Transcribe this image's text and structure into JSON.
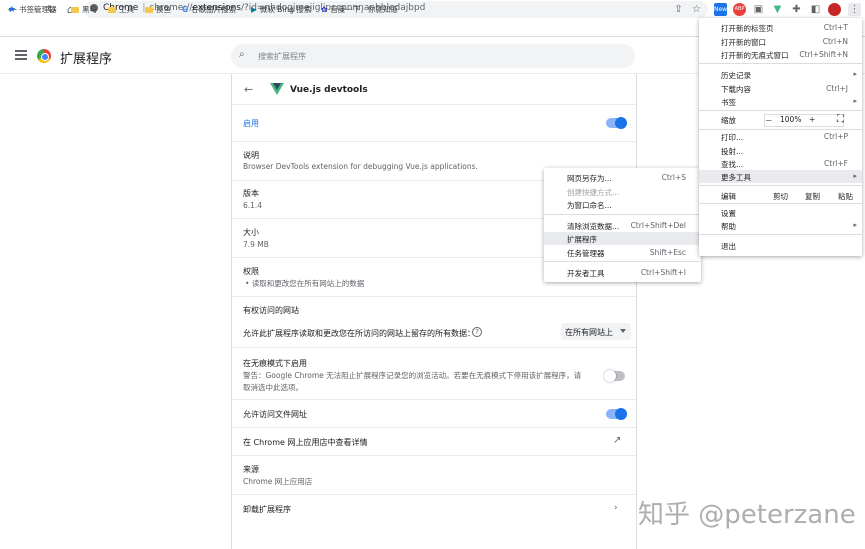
{
  "browser": {
    "site_label": "Chrome",
    "url_prefix": "chrome://",
    "url_main": "extensions",
    "url_rest": "/?id=nhdogjmejiglipccpnnnanhbledajbpd"
  },
  "bookmarks": [
    "书签管理器",
    "黑马",
    "工具",
    "摸鱼",
    "谷歌图片搜索",
    "微软 Bing 搜索",
    "百度一下，你就知道"
  ],
  "header": {
    "title": "扩展程序",
    "search_placeholder": "搜索扩展程序"
  },
  "extension": {
    "name": "Vue.js devtools",
    "enabled_label": "启用",
    "description_heading": "说明",
    "description": "Browser DevTools extension for debugging Vue.js applications.",
    "version_heading": "版本",
    "version": "6.1.4",
    "size_heading": "大小",
    "size": "7.9 MB",
    "permissions_heading": "权限",
    "permission_item": "读取和更改您在所有网站上的数据",
    "site_access_heading": "有权访问的网站",
    "site_access_desc": "允许此扩展程序读取和更改您在所访问的网站上留存的所有数据：",
    "site_access_value": "在所有网站上",
    "incognito_heading": "在无痕模式下启用",
    "incognito_warning_1": "警告：Google Chrome 无法阻止扩展程序记录您的浏览活动。若要在无痕模式下停用该扩展程序，请",
    "incognito_warning_2": "取消选中此选项。",
    "file_urls": "允许访问文件网址",
    "store_link": "在 Chrome 网上应用店中查看详情",
    "source_heading": "来源",
    "source": "Chrome 网上应用店",
    "uninstall": "卸载扩展程序",
    "toggles": {
      "enabled": true,
      "incognito": false,
      "file_urls": true
    }
  },
  "main_menu": {
    "new_tab": "打开新的标签页",
    "new_tab_sc": "Ctrl+T",
    "new_window": "打开新的窗口",
    "new_window_sc": "Ctrl+N",
    "incognito": "打开新的无痕式窗口",
    "incognito_sc": "Ctrl+Shift+N",
    "history": "历史记录",
    "downloads": "下载内容",
    "downloads_sc": "Ctrl+J",
    "bookmarks": "书签",
    "zoom": "缩放",
    "zoom_minus": "－",
    "zoom_value": "100%",
    "zoom_plus": "+",
    "print": "打印...",
    "print_sc": "Ctrl+P",
    "cast": "投射...",
    "find": "查找...",
    "find_sc": "Ctrl+F",
    "more_tools": "更多工具",
    "edit": "编辑",
    "cut": "剪切",
    "copy": "复制",
    "paste": "粘贴",
    "settings": "设置",
    "help": "帮助",
    "exit": "退出"
  },
  "sub_menu": {
    "save_page": "网页另存为...",
    "save_page_sc": "Ctrl+S",
    "create_shortcut": "创建快捷方式...",
    "name_window": "为窗口命名...",
    "clear_data": "清除浏览数据...",
    "clear_data_sc": "Ctrl+Shift+Del",
    "extensions": "扩展程序",
    "task_manager": "任务管理器",
    "task_manager_sc": "Shift+Esc",
    "dev_tools": "开发者工具",
    "dev_tools_sc": "Ctrl+Shift+I"
  },
  "ext_badges": {
    "abp": "ABP",
    "new": "New"
  },
  "watermark": "知乎 @peterzane"
}
